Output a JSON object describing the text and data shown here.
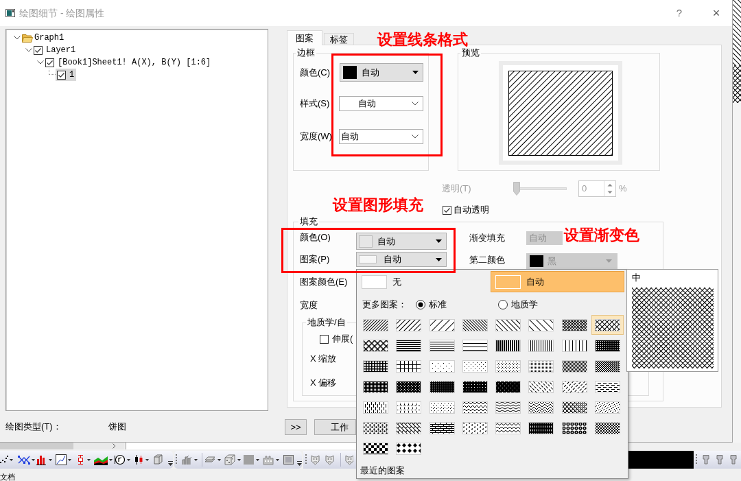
{
  "window": {
    "title": "绘图细节 - 绘图属性",
    "help_button": "?",
    "close_button": "×"
  },
  "tree": [
    {
      "kind": "folder",
      "label": "Graph1",
      "expanded": true,
      "selected": false,
      "children": [
        {
          "kind": "check",
          "label": "Layer1",
          "checked": true,
          "expanded": true,
          "selected": false,
          "children": [
            {
              "kind": "check",
              "label": "[Book1]Sheet1! A(X), B(Y) [1:6]",
              "checked": true,
              "expanded": true,
              "selected": false,
              "children": [
                {
                  "kind": "check",
                  "label": "1",
                  "checked": true,
                  "selected": true
                }
              ]
            }
          ]
        }
      ]
    }
  ],
  "plot_type": {
    "label": "绘图类型(T)：",
    "value": "饼图"
  },
  "buttons": [
    ">>",
    "工作"
  ],
  "tabs": [
    {
      "label": "图案",
      "selected": true
    },
    {
      "label": "标签",
      "selected": false
    }
  ],
  "border": {
    "title": "边框",
    "color": {
      "label": "颜色(C)",
      "value": "自动",
      "color": "#000000"
    },
    "style": {
      "label": "样式(S)",
      "value": "自动"
    },
    "width": {
      "label": "宽度(W)",
      "value": "自动"
    }
  },
  "preview": {
    "title": "预览"
  },
  "transparency": {
    "label": "透明(T)",
    "level": 0,
    "value": "0",
    "unit": "%",
    "disabled": true
  },
  "auto_transparency": {
    "label": "自动透明",
    "checked": true
  },
  "fill": {
    "title": "填充",
    "color": {
      "label": "颜色(O)",
      "value": "自动",
      "color": "#e6e6e6"
    },
    "pattern": {
      "label": "图案(P)",
      "value": "自动"
    },
    "gradient": {
      "label": "渐变填充",
      "value": "自动",
      "disabled": true
    },
    "second_color": {
      "label": "第二颜色",
      "value": "黑",
      "color": "#000000",
      "disabled": true
    },
    "pattern_color": {
      "label": "图案颜色(E)"
    },
    "width": {
      "label": "宽度"
    },
    "custom": {
      "title": "地质学/自",
      "stretch": {
        "label": "伸展(",
        "checked": false
      },
      "x_scale": "X 缩放",
      "x_offset": "X 偏移"
    }
  },
  "pattern_menu": {
    "options": [
      {
        "label": "无",
        "selected": false
      },
      {
        "label": "自动",
        "selected": true
      }
    ],
    "more_label": "更多图案：",
    "modes": [
      {
        "label": "标准",
        "selected": true
      },
      {
        "label": "地质学",
        "selected": false
      }
    ],
    "patterns": [
      {
        "kind": "diag1",
        "selected": false
      },
      {
        "kind": "diag2",
        "selected": false
      },
      {
        "kind": "diag3",
        "selected": false
      },
      {
        "kind": "back1",
        "selected": false
      },
      {
        "kind": "back2",
        "selected": false
      },
      {
        "kind": "back3",
        "selected": false
      },
      {
        "kind": "cross1",
        "selected": false
      },
      {
        "kind": "cross2",
        "selected": true
      },
      {
        "kind": "cross3",
        "selected": false
      },
      {
        "kind": "horiz1",
        "selected": false
      },
      {
        "kind": "horiz2",
        "selected": false
      },
      {
        "kind": "horiz3",
        "selected": false
      },
      {
        "kind": "vert1",
        "selected": false
      },
      {
        "kind": "vert2",
        "selected": false
      },
      {
        "kind": "vert3",
        "selected": false
      },
      {
        "kind": "grid1",
        "selected": false
      },
      {
        "kind": "grid2",
        "selected": false
      },
      {
        "kind": "grid3",
        "selected": false
      },
      {
        "kind": "dots1",
        "selected": false
      },
      {
        "kind": "dots2",
        "selected": false
      },
      {
        "kind": "dots3",
        "selected": false
      },
      {
        "kind": "dots4",
        "selected": false
      },
      {
        "kind": "dots5",
        "selected": false
      },
      {
        "kind": "dots6",
        "selected": false
      },
      {
        "kind": "dark1",
        "selected": false
      },
      {
        "kind": "dark2",
        "selected": false
      },
      {
        "kind": "black1",
        "selected": false
      },
      {
        "kind": "black2",
        "selected": false
      },
      {
        "kind": "black3",
        "selected": false
      },
      {
        "kind": "dashback",
        "selected": false
      },
      {
        "kind": "dashdiag",
        "selected": false
      },
      {
        "kind": "dashhoriz",
        "selected": false
      },
      {
        "kind": "dashvert",
        "selected": false
      },
      {
        "kind": "dashgrid",
        "selected": false
      },
      {
        "kind": "dotted",
        "selected": false
      },
      {
        "kind": "zigzag",
        "selected": false
      },
      {
        "kind": "waves",
        "selected": false
      },
      {
        "kind": "herringbone",
        "selected": false
      },
      {
        "kind": "weave",
        "selected": false
      },
      {
        "kind": "speckle",
        "selected": false
      },
      {
        "kind": "blobs",
        "selected": false
      },
      {
        "kind": "lattice",
        "selected": false
      },
      {
        "kind": "bricks",
        "selected": false
      },
      {
        "kind": "chevrons",
        "selected": false
      },
      {
        "kind": "scales",
        "selected": false
      },
      {
        "kind": "blackdots",
        "selected": false
      },
      {
        "kind": "circles",
        "selected": false
      },
      {
        "kind": "checkfine",
        "selected": false
      },
      {
        "kind": "checker",
        "selected": false
      },
      {
        "kind": "diamonds",
        "selected": false
      }
    ],
    "recent_label": "最近的图案",
    "preview_label": "中"
  },
  "annotations": [
    {
      "text": "设置线条格式"
    },
    {
      "text": "设置图形填充"
    },
    {
      "text": "设置渐变色"
    }
  ],
  "status_bar": {
    "text": "文档"
  }
}
